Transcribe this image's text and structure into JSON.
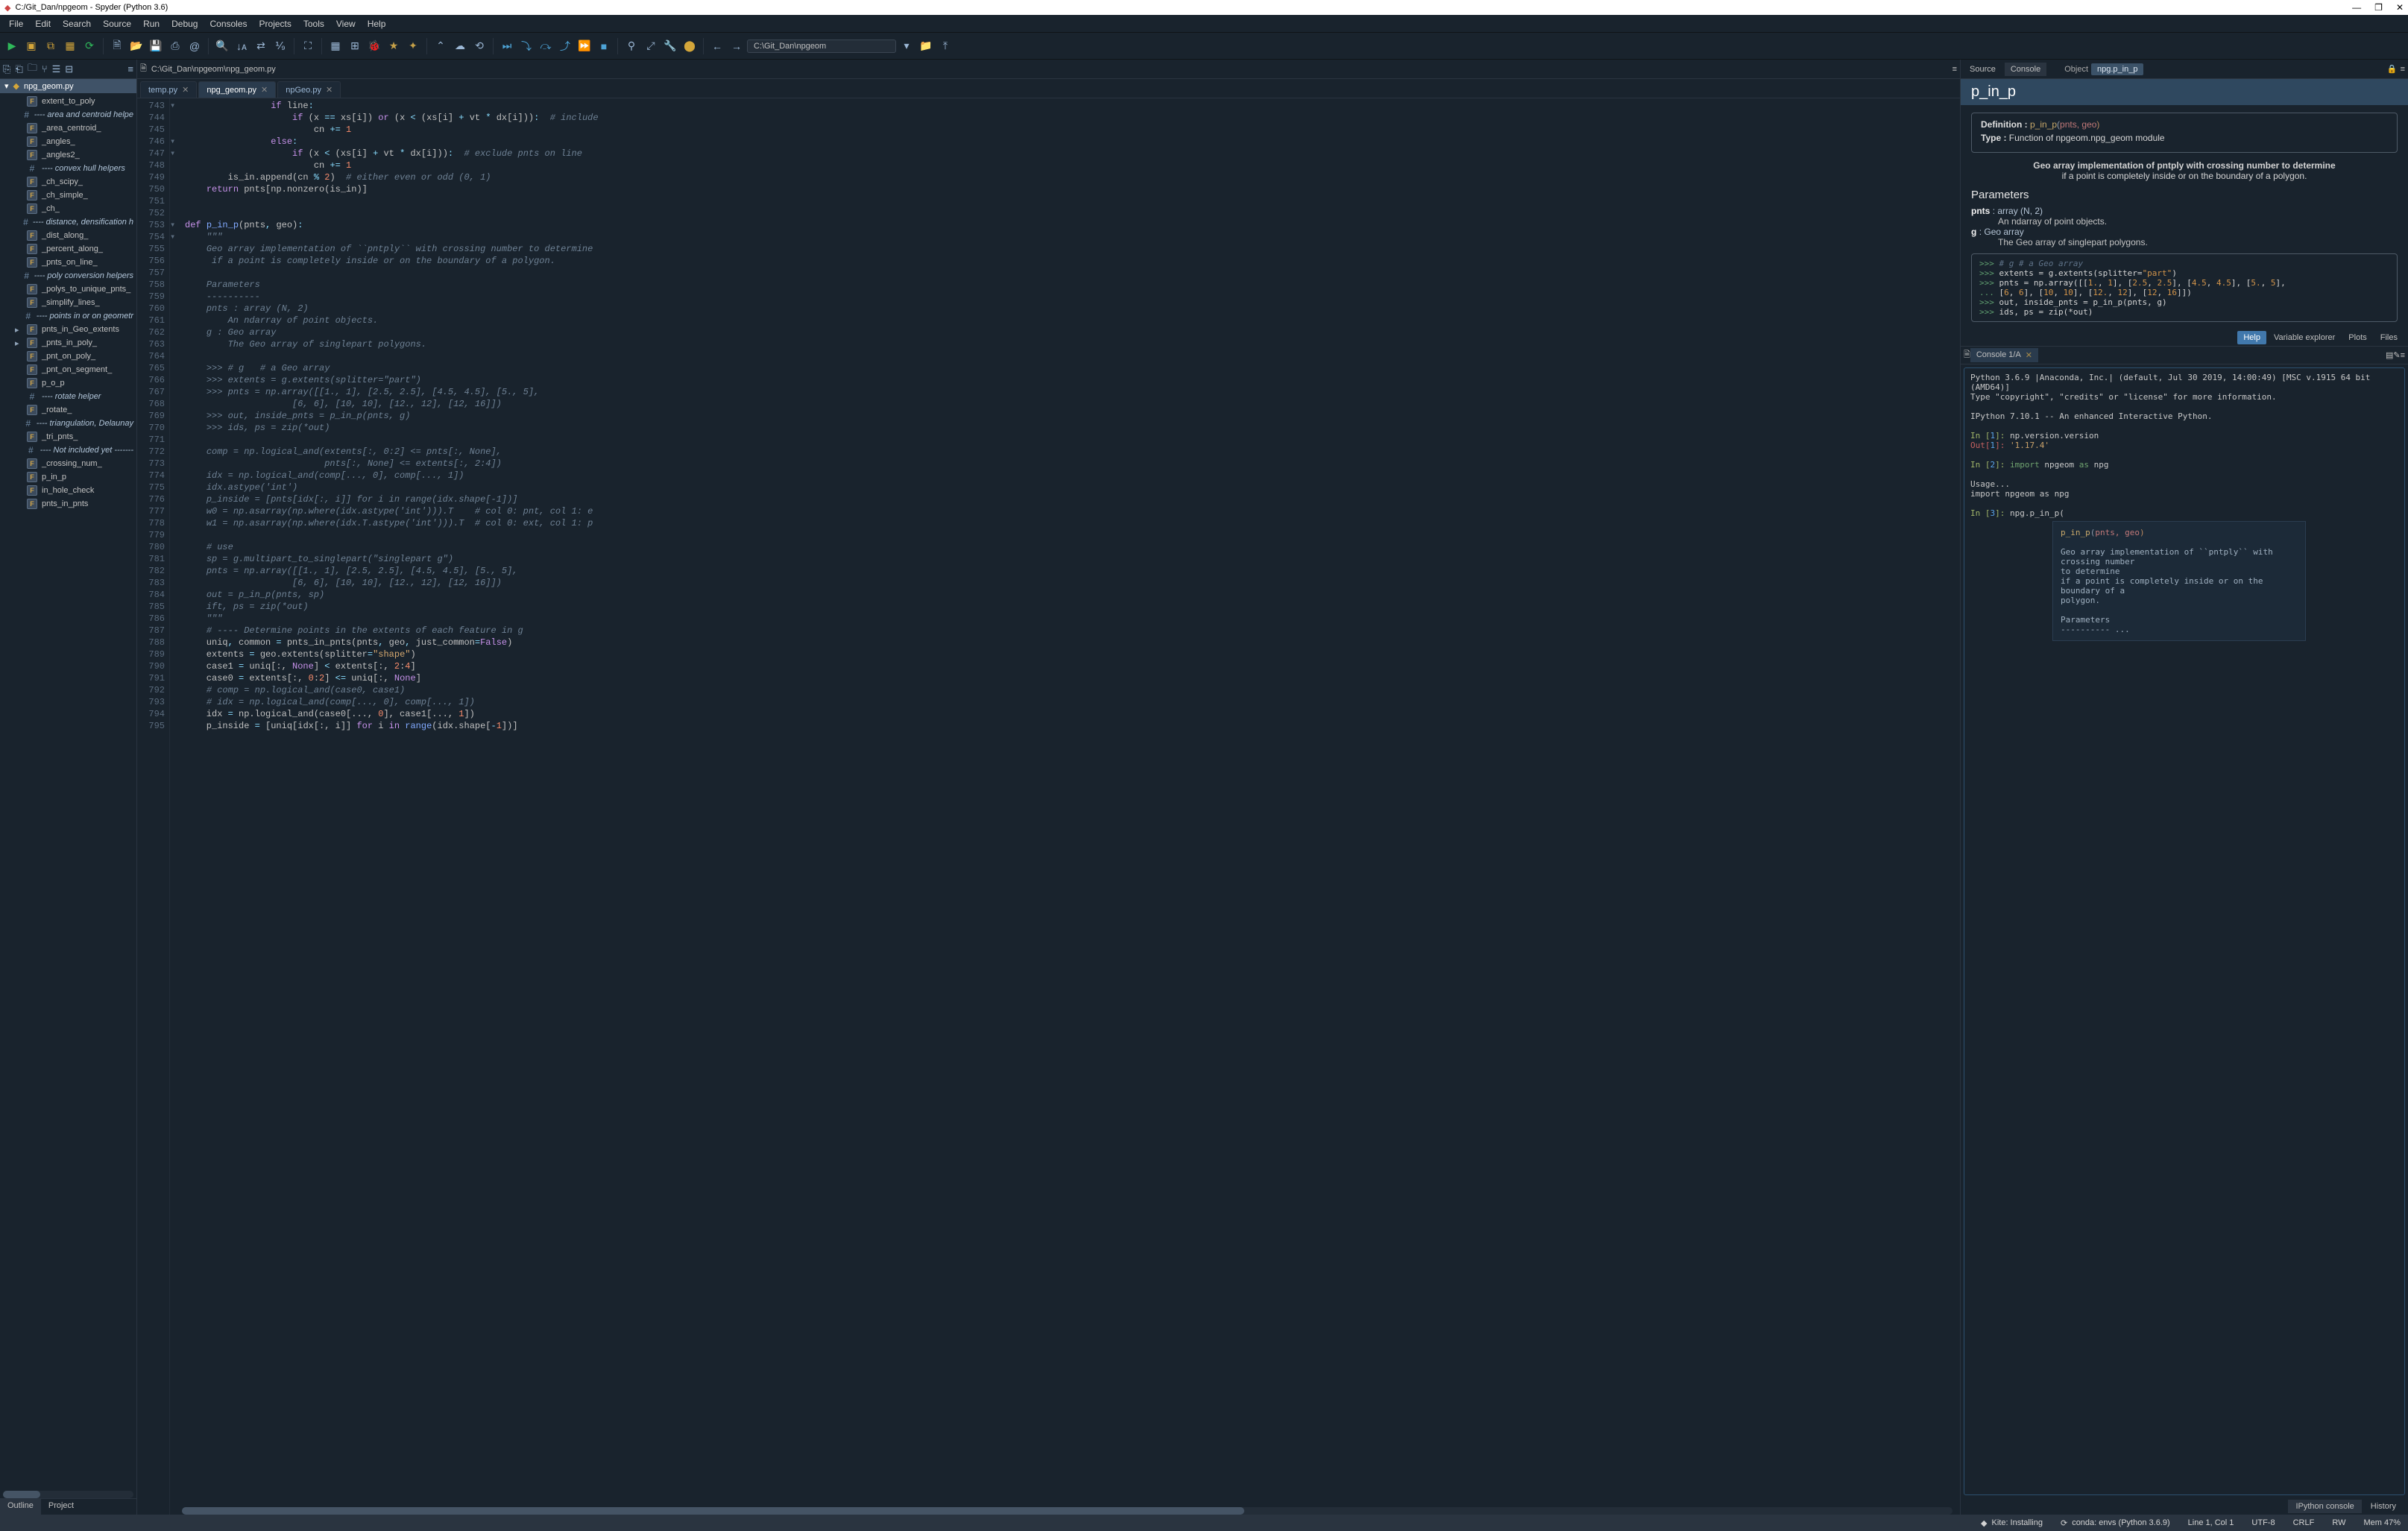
{
  "window": {
    "title": "C:/Git_Dan/npgeom - Spyder (Python 3.6)",
    "minimize": "—",
    "maximize": "❐",
    "close": "✕"
  },
  "menu": [
    "File",
    "Edit",
    "Search",
    "Source",
    "Run",
    "Debug",
    "Consoles",
    "Projects",
    "Tools",
    "View",
    "Help"
  ],
  "toolbar": {
    "path": "C:\\Git_Dan\\npgeom"
  },
  "editor": {
    "breadcrumb": "C:\\Git_Dan\\npgeom\\npg_geom.py",
    "tabs": [
      {
        "label": "temp.py",
        "active": false
      },
      {
        "label": "npg_geom.py",
        "active": true
      },
      {
        "label": "npGeo.py",
        "active": false
      }
    ],
    "first_line": 743,
    "lines": [
      {
        "n": 743,
        "fold": "▾",
        "html": "                <span class='k-kw'>if</span> line<span class='k-op'>:</span>"
      },
      {
        "n": 744,
        "fold": "",
        "html": "                    <span class='k-kw'>if</span> (x <span class='k-op'>==</span> xs[i]) <span class='k-kw'>or</span> (x <span class='k-op'>&lt;</span> (xs[i] <span class='k-op'>+</span> vt <span class='k-op'>*</span> dx[i]))<span class='k-op'>:</span>  <span class='k-com'># include</span>"
      },
      {
        "n": 745,
        "fold": "",
        "html": "                        cn <span class='k-op'>+=</span> <span class='k-num'>1</span>"
      },
      {
        "n": 746,
        "fold": "▾",
        "html": "                <span class='k-kw'>else</span><span class='k-op'>:</span>"
      },
      {
        "n": 747,
        "fold": "▾",
        "html": "                    <span class='k-kw'>if</span> (x <span class='k-op'>&lt;</span> (xs[i] <span class='k-op'>+</span> vt <span class='k-op'>*</span> dx[i]))<span class='k-op'>:</span>  <span class='k-com'># exclude pnts on line</span>"
      },
      {
        "n": 748,
        "fold": "",
        "html": "                        cn <span class='k-op'>+=</span> <span class='k-num'>1</span>"
      },
      {
        "n": 749,
        "fold": "",
        "html": "        is_in.append(cn <span class='k-op'>%</span> <span class='k-num'>2</span>)  <span class='k-com'># either even or odd (0, 1)</span>"
      },
      {
        "n": 750,
        "fold": "",
        "html": "    <span class='k-kw'>return</span> pnts[np.nonzero(is_in)]"
      },
      {
        "n": 751,
        "fold": "",
        "html": ""
      },
      {
        "n": 752,
        "fold": "",
        "html": ""
      },
      {
        "n": 753,
        "fold": "▾",
        "html": "<span class='k-kw'>def</span> <span class='k-fn'>p_in_p</span>(pnts<span class='k-op'>,</span> geo)<span class='k-op'>:</span>"
      },
      {
        "n": 754,
        "fold": "▾",
        "html": "    <span class='k-doc'>\"\"\"</span>"
      },
      {
        "n": 755,
        "fold": "",
        "html": "    <span class='k-doc'>Geo array implementation of ``pntply`` with crossing number to determine</span>"
      },
      {
        "n": 756,
        "fold": "",
        "html": "    <span class='k-doc'> if a point is completely inside or on the boundary of a polygon.</span>"
      },
      {
        "n": 757,
        "fold": "",
        "html": ""
      },
      {
        "n": 758,
        "fold": "",
        "html": "    <span class='k-doc'>Parameters</span>"
      },
      {
        "n": 759,
        "fold": "",
        "html": "    <span class='k-doc'>----------</span>"
      },
      {
        "n": 760,
        "fold": "",
        "html": "    <span class='k-doc'>pnts : array (N, 2)</span>"
      },
      {
        "n": 761,
        "fold": "",
        "html": "        <span class='k-doc'>An ndarray of point objects.</span>"
      },
      {
        "n": 762,
        "fold": "",
        "html": "    <span class='k-doc'>g : Geo array</span>"
      },
      {
        "n": 763,
        "fold": "",
        "html": "        <span class='k-doc'>The Geo array of singlepart polygons.</span>"
      },
      {
        "n": 764,
        "fold": "",
        "html": ""
      },
      {
        "n": 765,
        "fold": "",
        "html": "    <span class='k-doc'>&gt;&gt;&gt; # g   # a Geo array</span>"
      },
      {
        "n": 766,
        "fold": "",
        "html": "    <span class='k-doc'>&gt;&gt;&gt; extents = g.extents(splitter=\"part\")</span>"
      },
      {
        "n": 767,
        "fold": "",
        "html": "    <span class='k-doc'>&gt;&gt;&gt; pnts = np.array([[1., 1], [2.5, 2.5], [4.5, 4.5], [5., 5],</span>"
      },
      {
        "n": 768,
        "fold": "",
        "html": "                    <span class='k-doc'>[6, 6], [10, 10], [12., 12], [12, 16]])</span>"
      },
      {
        "n": 769,
        "fold": "",
        "html": "    <span class='k-doc'>&gt;&gt;&gt; out, inside_pnts = p_in_p(pnts, g)</span>"
      },
      {
        "n": 770,
        "fold": "",
        "html": "    <span class='k-doc'>&gt;&gt;&gt; ids, ps = zip(*out)</span>"
      },
      {
        "n": 771,
        "fold": "",
        "html": ""
      },
      {
        "n": 772,
        "fold": "",
        "html": "    <span class='k-doc'>comp = np.logical_and(extents[:, 0:2] &lt;= pnts[:, None],</span>"
      },
      {
        "n": 773,
        "fold": "",
        "html": "                          <span class='k-doc'>pnts[:, None] &lt;= extents[:, 2:4])</span>"
      },
      {
        "n": 774,
        "fold": "",
        "html": "    <span class='k-doc'>idx = np.logical_and(comp[..., 0], comp[..., 1])</span>"
      },
      {
        "n": 775,
        "fold": "",
        "html": "    <span class='k-doc'>idx.astype('int')</span>"
      },
      {
        "n": 776,
        "fold": "",
        "html": "    <span class='k-doc'>p_inside = [pnts[idx[:, i]] for i in range(idx.shape[-1])]</span>"
      },
      {
        "n": 777,
        "fold": "",
        "html": "    <span class='k-doc'>w0 = np.asarray(np.where(idx.astype('int'))).T    # col 0: pnt, col 1: e</span>"
      },
      {
        "n": 778,
        "fold": "",
        "html": "    <span class='k-doc'>w1 = np.asarray(np.where(idx.T.astype('int'))).T  # col 0: ext, col 1: p</span>"
      },
      {
        "n": 779,
        "fold": "",
        "html": ""
      },
      {
        "n": 780,
        "fold": "",
        "html": "    <span class='k-doc'># use</span>"
      },
      {
        "n": 781,
        "fold": "",
        "html": "    <span class='k-doc'>sp = g.multipart_to_singlepart(\"singlepart g\")</span>"
      },
      {
        "n": 782,
        "fold": "",
        "html": "    <span class='k-doc'>pnts = np.array([[1., 1], [2.5, 2.5], [4.5, 4.5], [5., 5],</span>"
      },
      {
        "n": 783,
        "fold": "",
        "html": "                    <span class='k-doc'>[6, 6], [10, 10], [12., 12], [12, 16]])</span>"
      },
      {
        "n": 784,
        "fold": "",
        "html": "    <span class='k-doc'>out = p_in_p(pnts, sp)</span>"
      },
      {
        "n": 785,
        "fold": "",
        "html": "    <span class='k-doc'>ift, ps = zip(*out)</span>"
      },
      {
        "n": 786,
        "fold": "",
        "html": "    <span class='k-doc'>\"\"\"</span>"
      },
      {
        "n": 787,
        "fold": "",
        "html": "    <span class='k-com'># ---- Determine points in the extents of each feature in g</span>"
      },
      {
        "n": 788,
        "fold": "",
        "html": "    uniq<span class='k-op'>,</span> common <span class='k-op'>=</span> pnts_in_pnts(pnts<span class='k-op'>,</span> geo<span class='k-op'>,</span> just_common<span class='k-op'>=</span><span class='k-kw'>False</span>)"
      },
      {
        "n": 789,
        "fold": "",
        "html": "    extents <span class='k-op'>=</span> geo.extents(splitter<span class='k-op'>=</span><span class='k-str'>\"shape\"</span>)"
      },
      {
        "n": 790,
        "fold": "",
        "html": "    case1 <span class='k-op'>=</span> uniq[:, <span class='k-kw'>None</span>] <span class='k-op'>&lt;</span> extents[:, <span class='k-num'>2</span>:<span class='k-num'>4</span>]"
      },
      {
        "n": 791,
        "fold": "",
        "html": "    case0 <span class='k-op'>=</span> extents[:, <span class='k-num'>0</span>:<span class='k-num'>2</span>] <span class='k-op'>&lt;=</span> uniq[:, <span class='k-kw'>None</span>]"
      },
      {
        "n": 792,
        "fold": "",
        "html": "    <span class='k-com'># comp = np.logical_and(case0, case1)</span>"
      },
      {
        "n": 793,
        "fold": "",
        "html": "    <span class='k-com'># idx = np.logical_and(comp[..., 0], comp[..., 1])</span>"
      },
      {
        "n": 794,
        "fold": "",
        "html": "    idx <span class='k-op'>=</span> np.logical_and(case0[..., <span class='k-num'>0</span>], case1[..., <span class='k-num'>1</span>])"
      },
      {
        "n": 795,
        "fold": "",
        "html": "    p_inside <span class='k-op'>=</span> [uniq[idx[:, i]] <span class='k-kw'>for</span> i <span class='k-kw'>in</span> <span class='k-fn'>range</span>(idx.shape[<span class='k-op'>-</span><span class='k-num'>1</span>])]"
      }
    ]
  },
  "outline": {
    "file": "npg_geom.py",
    "items": [
      {
        "type": "f",
        "label": "extent_to_poly",
        "exp": ""
      },
      {
        "type": "h",
        "label": "---- area and centroid helpe"
      },
      {
        "type": "f",
        "label": "_area_centroid_",
        "exp": ""
      },
      {
        "type": "f",
        "label": "_angles_",
        "exp": ""
      },
      {
        "type": "f",
        "label": "_angles2_",
        "exp": ""
      },
      {
        "type": "h",
        "label": "---- convex hull helpers"
      },
      {
        "type": "f",
        "label": "_ch_scipy_",
        "exp": ""
      },
      {
        "type": "f",
        "label": "_ch_simple_",
        "exp": ""
      },
      {
        "type": "f",
        "label": "_ch_",
        "exp": ""
      },
      {
        "type": "h",
        "label": "---- distance, densification h"
      },
      {
        "type": "f",
        "label": "_dist_along_",
        "exp": ""
      },
      {
        "type": "f",
        "label": "_percent_along_",
        "exp": ""
      },
      {
        "type": "f",
        "label": "_pnts_on_line_",
        "exp": ""
      },
      {
        "type": "h",
        "label": "---- poly conversion helpers"
      },
      {
        "type": "f",
        "label": "_polys_to_unique_pnts_",
        "exp": ""
      },
      {
        "type": "f",
        "label": "_simplify_lines_",
        "exp": ""
      },
      {
        "type": "h",
        "label": "---- points in or on geometr"
      },
      {
        "type": "f",
        "label": "pnts_in_Geo_extents",
        "exp": "▸"
      },
      {
        "type": "f",
        "label": "_pnts_in_poly_",
        "exp": "▸"
      },
      {
        "type": "f",
        "label": "_pnt_on_poly_",
        "exp": ""
      },
      {
        "type": "f",
        "label": "_pnt_on_segment_",
        "exp": ""
      },
      {
        "type": "f",
        "label": "p_o_p",
        "exp": ""
      },
      {
        "type": "h",
        "label": "---- rotate helper"
      },
      {
        "type": "f",
        "label": "_rotate_",
        "exp": ""
      },
      {
        "type": "h",
        "label": "---- triangulation, Delaunay"
      },
      {
        "type": "f",
        "label": "_tri_pnts_",
        "exp": ""
      },
      {
        "type": "h",
        "label": "---- Not included yet -------"
      },
      {
        "type": "f",
        "label": "_crossing_num_",
        "exp": ""
      },
      {
        "type": "f",
        "label": "p_in_p",
        "exp": ""
      },
      {
        "type": "f",
        "label": "in_hole_check",
        "exp": ""
      },
      {
        "type": "f",
        "label": "pnts_in_pnts",
        "exp": ""
      }
    ],
    "bottom_tabs": {
      "outline": "Outline",
      "project": "Project"
    }
  },
  "right_top": {
    "source": "Source",
    "console": "Console",
    "object": "Object",
    "object_value": "npg.p_in_p",
    "lock": "🔒"
  },
  "help": {
    "title": "p_in_p",
    "def_label": "Definition :",
    "def_fn": "p_in_p",
    "def_args": "pnts, geo",
    "type_label": "Type :",
    "type_value": "Function of npgeom.npg_geom module",
    "desc1": "Geo array implementation of pntply with crossing number to determine",
    "desc2": "if a point is completely inside or on the boundary of a polygon.",
    "parameters_title": "Parameters",
    "params": [
      {
        "name": "pnts",
        "type": ": array (N, 2)",
        "desc": "An ndarray of point objects."
      },
      {
        "name": "g",
        "type": ": Geo array",
        "desc": "The Geo array of singlepart polygons."
      }
    ],
    "code_lines": [
      "<span class='pp'>&gt;&gt;&gt;</span> <span class='pp-c'># g   # a Geo array</span>",
      "<span class='pp'>&gt;&gt;&gt;</span> extents = g.extents(splitter=<span class='str'>\"part\"</span>)",
      "<span class='pp'>&gt;&gt;&gt;</span> pnts = np.array([[<span class='num'>1.</span>, <span class='num'>1</span>], [<span class='num'>2.5</span>, <span class='num'>2.5</span>], [<span class='num'>4.5</span>, <span class='num'>4.5</span>], [<span class='num'>5.</span>, <span class='num'>5</span>],",
      "<span class='pp'>...</span>                 [<span class='num'>6</span>, <span class='num'>6</span>], [<span class='num'>10</span>, <span class='num'>10</span>], [<span class='num'>12.</span>, <span class='num'>12</span>], [<span class='num'>12</span>, <span class='num'>16</span>]])",
      "<span class='pp'>&gt;&gt;&gt;</span> out, inside_pnts = p_in_p(pnts, g)",
      "<span class='pp'>&gt;&gt;&gt;</span> ids, ps = zip(*out)"
    ],
    "bottom_tabs": [
      "Help",
      "Variable explorer",
      "Plots",
      "Files"
    ]
  },
  "console": {
    "tab": "Console 1/A",
    "banner1": "Python 3.6.9 |Anaconda, Inc.| (default, Jul 30 2019, 14:00:49) [MSC v.1915 64 bit (AMD64)]",
    "banner2": "Type \"copyright\", \"credits\" or \"license\" for more information.",
    "banner3": "IPython 7.10.1 -- An enhanced Interactive Python.",
    "in1": "np.version.version",
    "out1": "'1.17.4'",
    "in2": "import npgeom as npg",
    "usage1": "Usage...",
    "usage2": "  import npgeom as npg",
    "in3": "npg.p_in_p(",
    "tooltip": {
      "sig_fn": "p_in_p",
      "sig_args": "pnts, geo",
      "l1": "Geo array implementation of ``pntply`` with crossing number",
      "l2": "to determine",
      "l3": "if a point is completely inside or on the boundary of a",
      "l4": "polygon.",
      "l5": "Parameters",
      "l6": "---------- ..."
    },
    "bottom_tabs": [
      "IPython console",
      "History"
    ]
  },
  "status": {
    "kite": "Kite: Installing",
    "conda": "conda: envs (Python 3.6.9)",
    "line": "Line 1, Col 1",
    "enc": "UTF-8",
    "eol": "CRLF",
    "rw": "RW",
    "mem": "Mem 47%"
  }
}
